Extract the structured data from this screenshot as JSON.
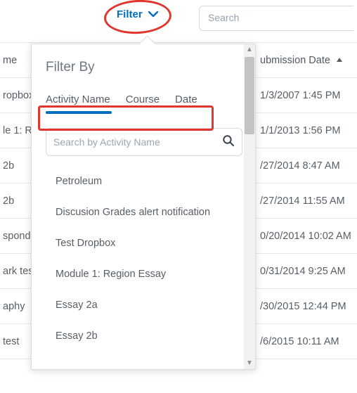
{
  "toolbar": {
    "filter_label": "Filter",
    "search_placeholder": "Search"
  },
  "table": {
    "name_header": "me",
    "date_header": "ubmission Date",
    "rows": [
      {
        "name": "ropbox",
        "date": "1/3/2007 1:45 PM"
      },
      {
        "name": "le 1: Re",
        "date": "1/1/2013 1:56 PM"
      },
      {
        "name": "2b",
        "date": "/27/2014 8:47 AM"
      },
      {
        "name": "2b",
        "date": "/27/2014 11:55 AM"
      },
      {
        "name": "spond",
        "date": "0/20/2014 10:02 AM"
      },
      {
        "name": "ark tes",
        "date": "0/31/2014 9:25 AM"
      },
      {
        "name": "aphy",
        "date": "/30/2015 12:44 PM"
      },
      {
        "name": "test",
        "date": "/6/2015 10:11 AM"
      }
    ]
  },
  "popover": {
    "title": "Filter By",
    "tabs": {
      "activity": "Activity Name",
      "course": "Course",
      "date": "Date"
    },
    "search_placeholder": "Search by Activity Name",
    "activities": [
      "Petroleum",
      "Discusion Grades alert notification",
      "Test Dropbox",
      "Module 1: Region Essay",
      "Essay 2a",
      "Essay 2b"
    ]
  }
}
